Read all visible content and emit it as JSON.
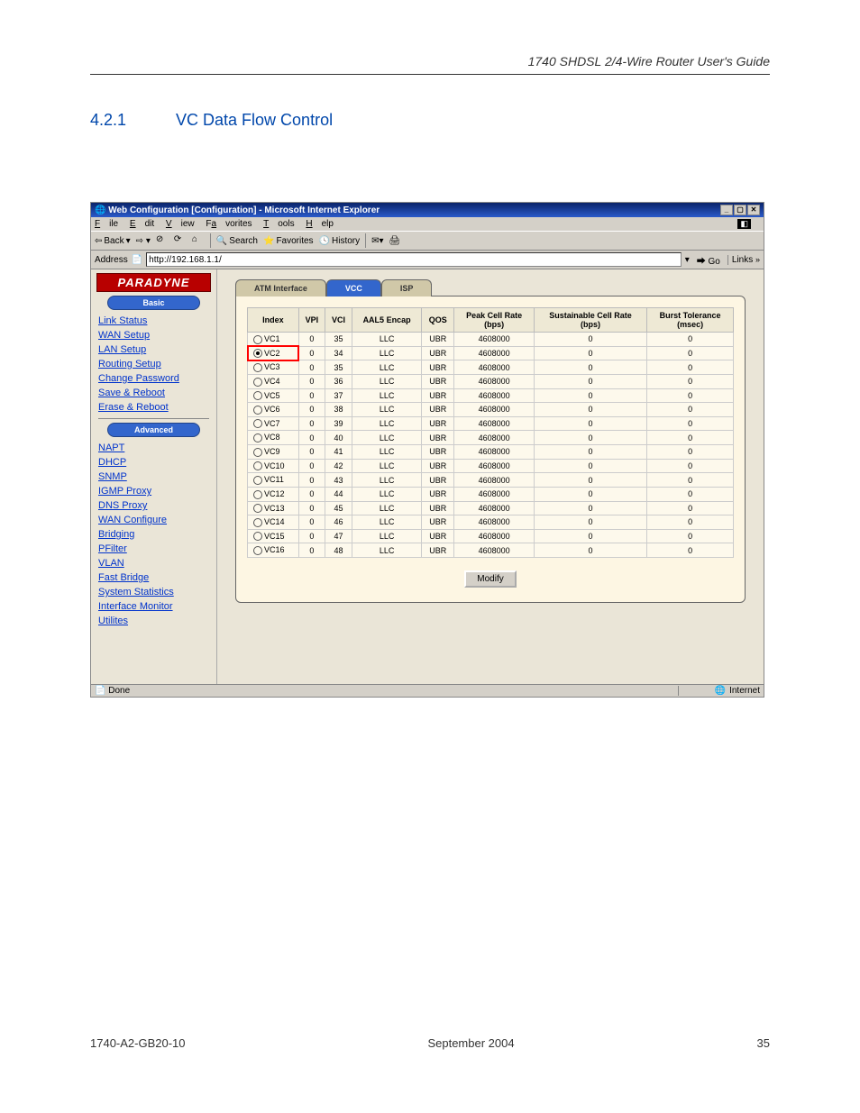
{
  "doc": {
    "guide_title": "1740 SHDSL 2/4-Wire Router User's Guide",
    "section_number": "4.2.1",
    "section_title": "VC Data Flow Control",
    "footer_left": "1740-A2-GB20-10",
    "footer_center": "September 2004",
    "footer_right": "35"
  },
  "browser": {
    "title": "Web Configuration [Configuration] - Microsoft Internet Explorer",
    "menu": [
      "File",
      "Edit",
      "View",
      "Favorites",
      "Tools",
      "Help"
    ],
    "toolbar": {
      "back": "Back",
      "search": "Search",
      "favorites": "Favorites",
      "history": "History"
    },
    "address_label": "Address",
    "address_value": "http://192.168.1.1/",
    "go": "Go",
    "links": "Links",
    "status_left": "Done",
    "status_right": "Internet"
  },
  "sidebar": {
    "brand": "PARADYNE",
    "basic_label": "Basic",
    "basic_links": [
      "Link Status",
      "WAN Setup",
      "LAN Setup",
      "Routing Setup",
      "Change Password",
      "Save & Reboot",
      "Erase & Reboot"
    ],
    "advanced_label": "Advanced",
    "advanced_links": [
      "NAPT",
      "DHCP",
      "SNMP",
      "IGMP Proxy",
      "DNS Proxy",
      "WAN Configure",
      "Bridging",
      "PFilter",
      "VLAN",
      "Fast Bridge",
      "System Statistics",
      "Interface Monitor",
      "Utilites"
    ]
  },
  "main": {
    "tabs": {
      "t1": "ATM Interface",
      "t2": "VCC",
      "t3": "ISP"
    },
    "headers": [
      "Index",
      "VPI",
      "VCI",
      "AAL5 Encap",
      "QOS",
      "Peak Cell Rate (bps)",
      "Sustainable Cell Rate (bps)",
      "Burst Tolerance (msec)"
    ],
    "rows": [
      {
        "idx": "VC1",
        "vpi": "0",
        "vci": "35",
        "encap": "LLC",
        "qos": "UBR",
        "peak": "4608000",
        "sust": "0",
        "burst": "0",
        "sel": false,
        "hl": false
      },
      {
        "idx": "VC2",
        "vpi": "0",
        "vci": "34",
        "encap": "LLC",
        "qos": "UBR",
        "peak": "4608000",
        "sust": "0",
        "burst": "0",
        "sel": true,
        "hl": true
      },
      {
        "idx": "VC3",
        "vpi": "0",
        "vci": "35",
        "encap": "LLC",
        "qos": "UBR",
        "peak": "4608000",
        "sust": "0",
        "burst": "0",
        "sel": false,
        "hl": false
      },
      {
        "idx": "VC4",
        "vpi": "0",
        "vci": "36",
        "encap": "LLC",
        "qos": "UBR",
        "peak": "4608000",
        "sust": "0",
        "burst": "0",
        "sel": false,
        "hl": false
      },
      {
        "idx": "VC5",
        "vpi": "0",
        "vci": "37",
        "encap": "LLC",
        "qos": "UBR",
        "peak": "4608000",
        "sust": "0",
        "burst": "0",
        "sel": false,
        "hl": false
      },
      {
        "idx": "VC6",
        "vpi": "0",
        "vci": "38",
        "encap": "LLC",
        "qos": "UBR",
        "peak": "4608000",
        "sust": "0",
        "burst": "0",
        "sel": false,
        "hl": false
      },
      {
        "idx": "VC7",
        "vpi": "0",
        "vci": "39",
        "encap": "LLC",
        "qos": "UBR",
        "peak": "4608000",
        "sust": "0",
        "burst": "0",
        "sel": false,
        "hl": false
      },
      {
        "idx": "VC8",
        "vpi": "0",
        "vci": "40",
        "encap": "LLC",
        "qos": "UBR",
        "peak": "4608000",
        "sust": "0",
        "burst": "0",
        "sel": false,
        "hl": false
      },
      {
        "idx": "VC9",
        "vpi": "0",
        "vci": "41",
        "encap": "LLC",
        "qos": "UBR",
        "peak": "4608000",
        "sust": "0",
        "burst": "0",
        "sel": false,
        "hl": false
      },
      {
        "idx": "VC10",
        "vpi": "0",
        "vci": "42",
        "encap": "LLC",
        "qos": "UBR",
        "peak": "4608000",
        "sust": "0",
        "burst": "0",
        "sel": false,
        "hl": false
      },
      {
        "idx": "VC11",
        "vpi": "0",
        "vci": "43",
        "encap": "LLC",
        "qos": "UBR",
        "peak": "4608000",
        "sust": "0",
        "burst": "0",
        "sel": false,
        "hl": false
      },
      {
        "idx": "VC12",
        "vpi": "0",
        "vci": "44",
        "encap": "LLC",
        "qos": "UBR",
        "peak": "4608000",
        "sust": "0",
        "burst": "0",
        "sel": false,
        "hl": false
      },
      {
        "idx": "VC13",
        "vpi": "0",
        "vci": "45",
        "encap": "LLC",
        "qos": "UBR",
        "peak": "4608000",
        "sust": "0",
        "burst": "0",
        "sel": false,
        "hl": false
      },
      {
        "idx": "VC14",
        "vpi": "0",
        "vci": "46",
        "encap": "LLC",
        "qos": "UBR",
        "peak": "4608000",
        "sust": "0",
        "burst": "0",
        "sel": false,
        "hl": false
      },
      {
        "idx": "VC15",
        "vpi": "0",
        "vci": "47",
        "encap": "LLC",
        "qos": "UBR",
        "peak": "4608000",
        "sust": "0",
        "burst": "0",
        "sel": false,
        "hl": false
      },
      {
        "idx": "VC16",
        "vpi": "0",
        "vci": "48",
        "encap": "LLC",
        "qos": "UBR",
        "peak": "4608000",
        "sust": "0",
        "burst": "0",
        "sel": false,
        "hl": false
      }
    ],
    "modify": "Modify"
  }
}
